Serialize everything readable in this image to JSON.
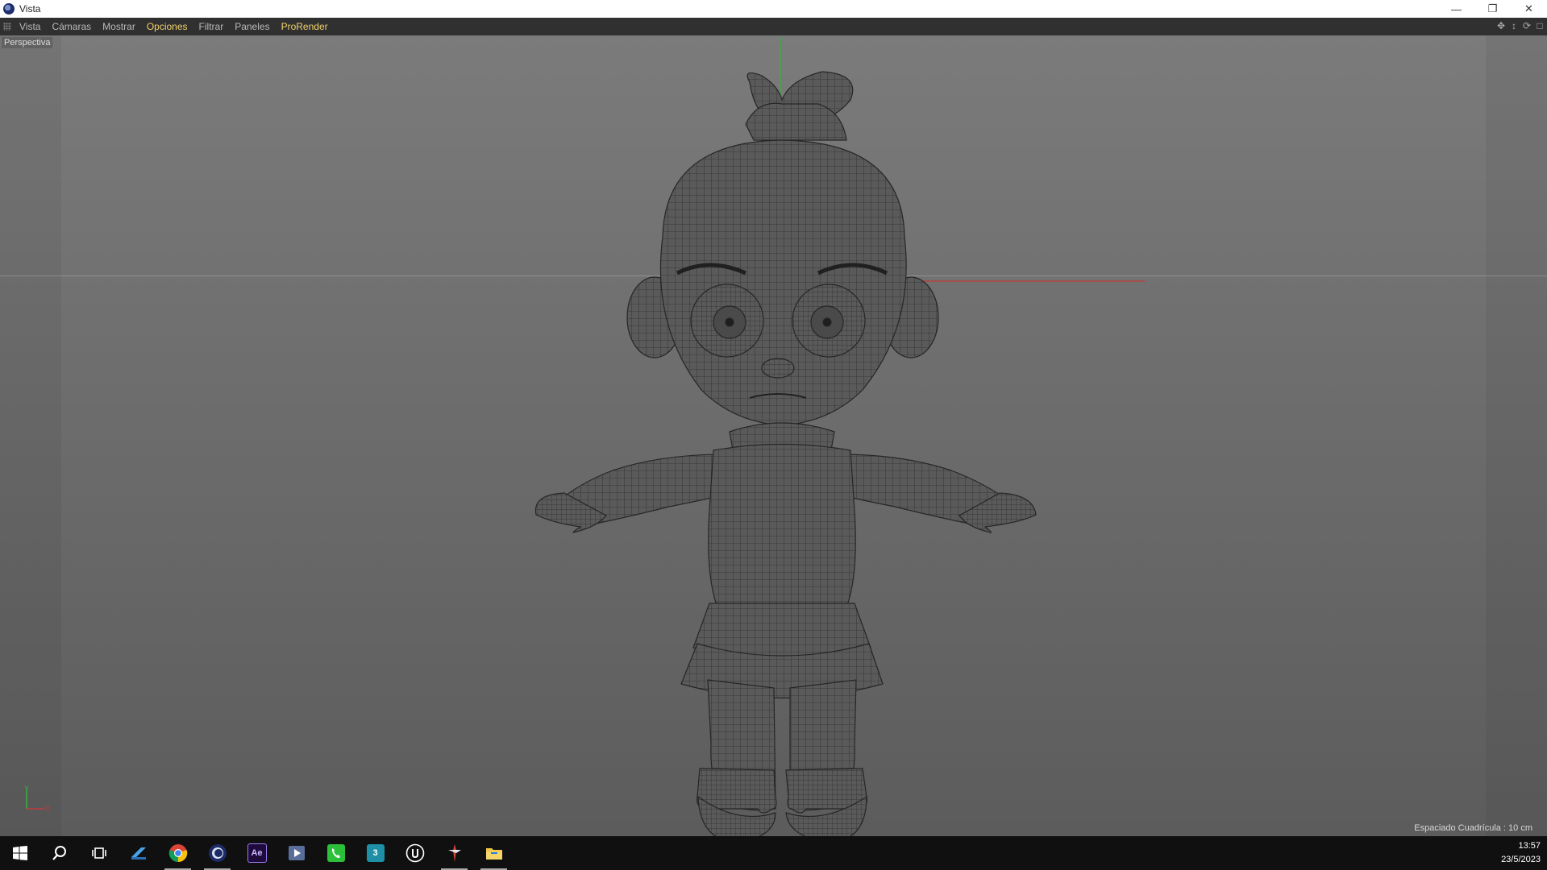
{
  "window": {
    "title": "Vista"
  },
  "menu": {
    "items": [
      {
        "label": "Vista",
        "active": false
      },
      {
        "label": "Cámaras",
        "active": false
      },
      {
        "label": "Mostrar",
        "active": false
      },
      {
        "label": "Opciones",
        "active": true
      },
      {
        "label": "Filtrar",
        "active": false
      },
      {
        "label": "Paneles",
        "active": false
      },
      {
        "label": "ProRender",
        "active": true
      }
    ],
    "nav_icons": [
      "move-icon",
      "zoom-icon",
      "rotate-icon",
      "maximize-icon"
    ]
  },
  "viewport": {
    "camera_label": "Perspectiva",
    "grid_spacing": "Espaciado Cuadrícula : 10 cm",
    "axis_labels": {
      "y": "Y",
      "x": "X"
    },
    "background_top": "#7b7b7b",
    "background_bottom": "#5c5c5c",
    "axis_colors": {
      "y": "#3fae3f",
      "x": "#c23a3a"
    }
  },
  "taskbar": {
    "icons": [
      {
        "name": "start-icon",
        "running": false
      },
      {
        "name": "search-icon",
        "running": false
      },
      {
        "name": "task-view-icon",
        "running": false
      },
      {
        "name": "app-blue-icon",
        "running": false
      },
      {
        "name": "chrome-icon",
        "running": true
      },
      {
        "name": "cinema4d-icon",
        "running": true
      },
      {
        "name": "after-effects-icon",
        "running": false
      },
      {
        "name": "media-player-icon",
        "running": false
      },
      {
        "name": "phone-icon",
        "running": false
      },
      {
        "name": "3dsmax-icon",
        "running": false
      },
      {
        "name": "unreal-icon",
        "running": false
      },
      {
        "name": "zbrush-icon",
        "running": true
      },
      {
        "name": "file-explorer-icon",
        "running": true
      }
    ],
    "labels": {
      "after_effects": "Ae",
      "max": "3"
    },
    "clock": {
      "time": "13:57",
      "date": "23/5/2023"
    }
  }
}
